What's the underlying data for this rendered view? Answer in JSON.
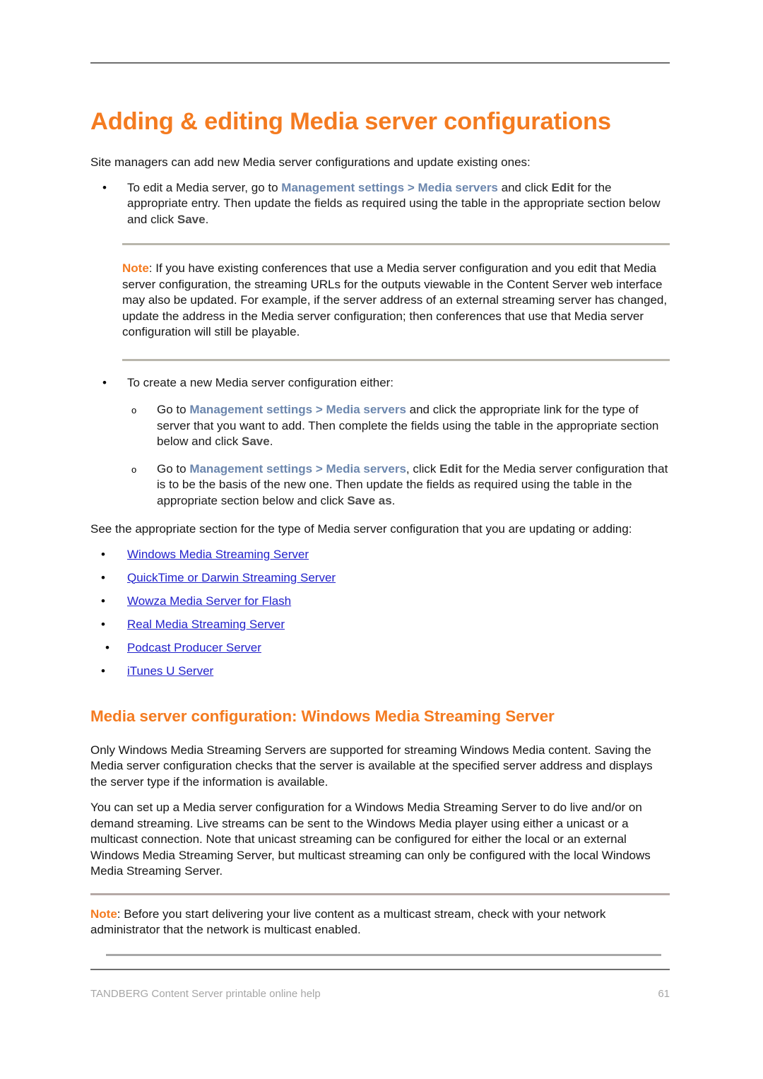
{
  "document": {
    "title": "Adding & editing Media server configurations",
    "intro": "Site managers can add new Media server configurations and update existing ones:",
    "bullet1": {
      "marker": "•",
      "part1": "To edit a Media server, go to ",
      "ui_path": "Management settings > Media servers",
      "part2": " and click ",
      "bold1": "Edit",
      "part3": " for the appropriate entry. Then update the fields as required using the table in the appropriate section below and click ",
      "bold2": "Save",
      "part4": "."
    },
    "note1": {
      "label": "Note",
      "text": ": If you have existing conferences that use a Media server configuration and you edit that Media server configuration, the streaming URLs for the outputs viewable in the Content Server web interface may also be updated. For example, if the server address of an external streaming server has changed, update the address in the Media server configuration; then conferences that use that Media server configuration will still be playable."
    },
    "bullet2": {
      "marker": "•",
      "text": "To create a new Media server configuration either:"
    },
    "sub_bullets": [
      {
        "marker": "o",
        "part1": "Go to ",
        "ui_path": "Management settings > Media servers",
        "part2": " and click the appropriate link for the type of server that you want to add. Then complete the fields using the table in the appropriate section below and click ",
        "bold1": "Save",
        "part3": "."
      },
      {
        "marker": "o",
        "part1": "Go to ",
        "ui_path": "Management settings > Media servers",
        "part2": ", click ",
        "bold1": "Edit",
        "part3": " for the Media server configuration that is to be the basis of the new one. Then update the fields as required using the table in the appropriate section below and click ",
        "bold2": "Save as",
        "part4": "."
      }
    ],
    "see_also_intro": "See the appropriate section for the type of Media server configuration that you are updating or adding:",
    "links": [
      {
        "marker": "•",
        "label": "Windows Media Streaming Server"
      },
      {
        "marker": "•",
        "label": "QuickTime or Darwin Streaming Server"
      },
      {
        "marker": "•",
        "label": "Wowza Media Server for Flash"
      },
      {
        "marker": "•",
        "label": "Real Media Streaming Server"
      },
      {
        "marker": "•",
        "label": "Podcast Producer Server"
      },
      {
        "marker": "•",
        "label": "iTunes U Server"
      }
    ],
    "subtitle": "Media server configuration: Windows Media Streaming Server",
    "para1": "Only Windows Media Streaming Servers are supported for streaming Windows Media content. Saving the Media server configuration checks that the server is available at the specified server address and displays the server type if the information is available.",
    "para2": "You can set up a Media server configuration for a Windows Media Streaming Server to do live and/or on demand streaming. Live streams can be sent to the Windows Media player using either a unicast or a multicast connection. Note that unicast streaming can be configured for either the local or an external Windows Media Streaming Server, but multicast streaming can only be configured with the local Windows Media Streaming Server.",
    "note2": {
      "label": "Note",
      "text": ": Before you start delivering your live content as a multicast stream, check with your network administrator that the network is multicast enabled."
    }
  },
  "footer": {
    "text": "TANDBERG Content Server printable online help",
    "page_number": "61"
  },
  "colors": {
    "accent_orange": "#f47b20",
    "ui_path_blue": "#6b86ad",
    "link_blue": "#2222cc",
    "footer_gray": "#a6a6a6",
    "rule_gray": "#6e6e6e"
  }
}
